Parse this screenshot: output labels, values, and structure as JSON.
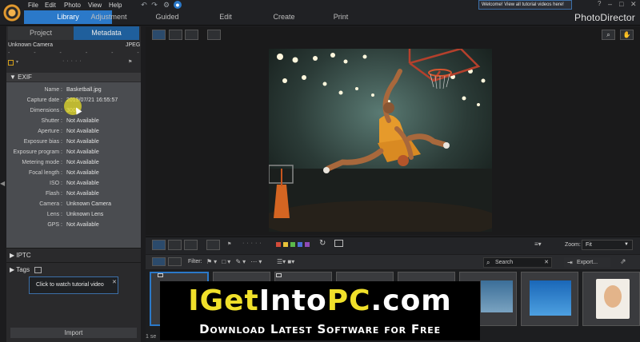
{
  "menu": [
    "File",
    "Edit",
    "Photo",
    "View",
    "Help"
  ],
  "modes": {
    "library": "Library",
    "adjustment": "Adjustment",
    "guided": "Guided",
    "edit": "Edit",
    "create": "Create",
    "print": "Print"
  },
  "app_name": "PhotoDirector",
  "welcome": "Welcome! View all tutorial videos here!",
  "help_glyph": "?",
  "panel_tabs": {
    "project": "Project",
    "metadata": "Metadata"
  },
  "camera": "Unknown Camera",
  "format": "JPEG",
  "exif": {
    "title": "EXIF",
    "rows": [
      {
        "label": "Name :",
        "value": "Basketball.jpg"
      },
      {
        "label": "Capture date :",
        "value": "2019/07/21 16:55:57"
      },
      {
        "label": "Dimensions :",
        "value": "3000"
      },
      {
        "label": "Shutter :",
        "value": "Not Available"
      },
      {
        "label": "Aperture :",
        "value": "Not Available"
      },
      {
        "label": "Exposure bias :",
        "value": "Not Available"
      },
      {
        "label": "Exposure program :",
        "value": "Not Available"
      },
      {
        "label": "Metering mode :",
        "value": "Not Available"
      },
      {
        "label": "Focal length :",
        "value": "Not Available"
      },
      {
        "label": "ISO :",
        "value": "Not Available"
      },
      {
        "label": "Flash :",
        "value": "Not Available"
      },
      {
        "label": "Camera :",
        "value": "Unknown Camera"
      },
      {
        "label": "Lens :",
        "value": "Unknown Lens"
      },
      {
        "label": "GPS :",
        "value": "Not Available"
      }
    ]
  },
  "iptc": "IPTC",
  "tags": "Tags",
  "tooltip": "Click to watch tutorial video",
  "import": "Import",
  "zoom": {
    "label": "Zoom:",
    "value": "Fit"
  },
  "filter_label": "Filter:",
  "search_placeholder": "Search",
  "export": "Export...",
  "status": "1 se",
  "banner": {
    "part1": "IGet",
    "part2": "Into",
    "part3": "PC",
    "part4": ".com",
    "sub": "Download Latest Software for Free"
  },
  "colors": {
    "accent": "#2b79c9",
    "label_red": "#d24b3a",
    "label_yellow": "#e7c23a",
    "label_blue": "#4a6fd6",
    "label_purple": "#8f4ab6"
  }
}
